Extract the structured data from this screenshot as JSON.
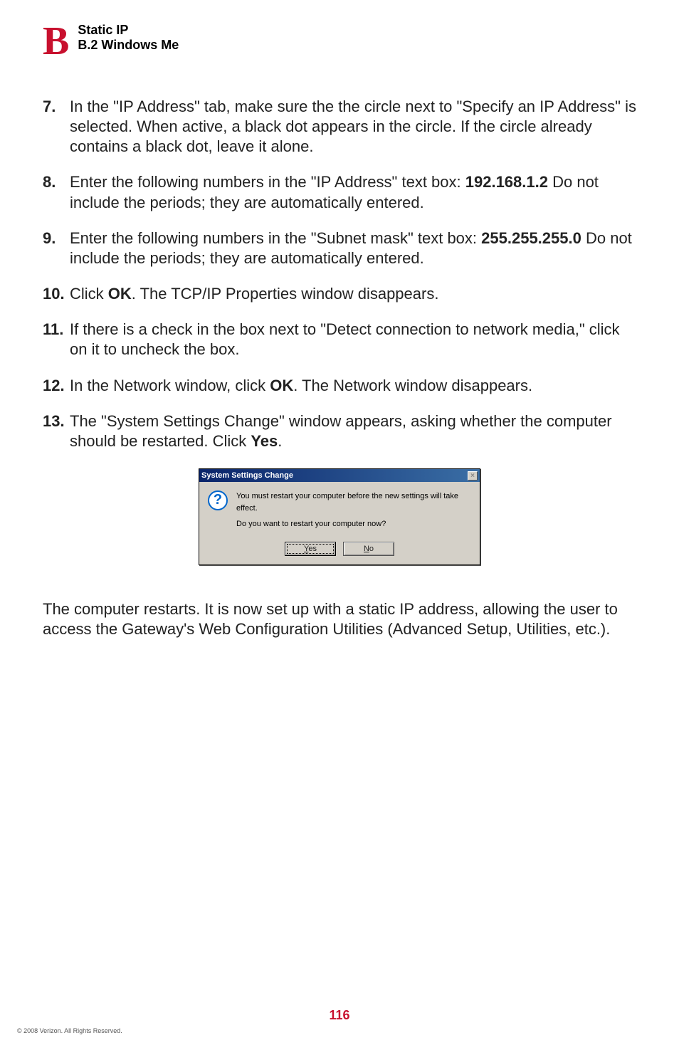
{
  "header": {
    "letter": "B",
    "title": "Static IP",
    "subtitle": "B.2  Windows Me"
  },
  "steps": [
    {
      "num": "7.",
      "text": "In the \"IP Address\" tab, make sure the the circle next to \"Specify an IP Address\" is selected. When active, a black dot appears in the circle. If the circle already contains a black dot, leave it alone."
    },
    {
      "num": "8.",
      "pre": "Enter the following numbers in the \"IP Address\" text box: ",
      "bold": "192.168.1.2",
      "post": " Do not include the periods; they are automatically entered."
    },
    {
      "num": "9.",
      "pre": "Enter the following numbers in the \"Subnet mask\" text box: ",
      "bold": "255.255.255.0",
      "post": " Do not include the periods; they are automatically entered."
    },
    {
      "num": "10.",
      "pre": "Click ",
      "bold": "OK",
      "post": ". The TCP/IP Properties window disappears."
    },
    {
      "num": "11.",
      "text": "If there is a check in the box next to \"Detect connection to network media,\" click on it to uncheck the box."
    },
    {
      "num": "12.",
      "pre": "In the Network window, click ",
      "bold": "OK",
      "post": ". The Network window disappears."
    },
    {
      "num": "13.",
      "pre": "The \"System Settings Change\" window appears, asking whether the computer should be restarted. Click ",
      "bold": "Yes",
      "post": "."
    }
  ],
  "dialog": {
    "title": "System Settings Change",
    "line1": "You must restart your computer before the new settings will take effect.",
    "line2": "Do you want to restart your computer now?",
    "yes_u": "Y",
    "yes_rest": "es",
    "no_u": "N",
    "no_rest": "o",
    "close_glyph": "×"
  },
  "after": "The computer restarts. It is now set up with a static IP address, allowing the user to access the Gateway's Web Configuration Utilities (Advanced Setup, Utilities, etc.).",
  "page_number": "116",
  "copyright": "© 2008 Verizon. All Rights Reserved."
}
